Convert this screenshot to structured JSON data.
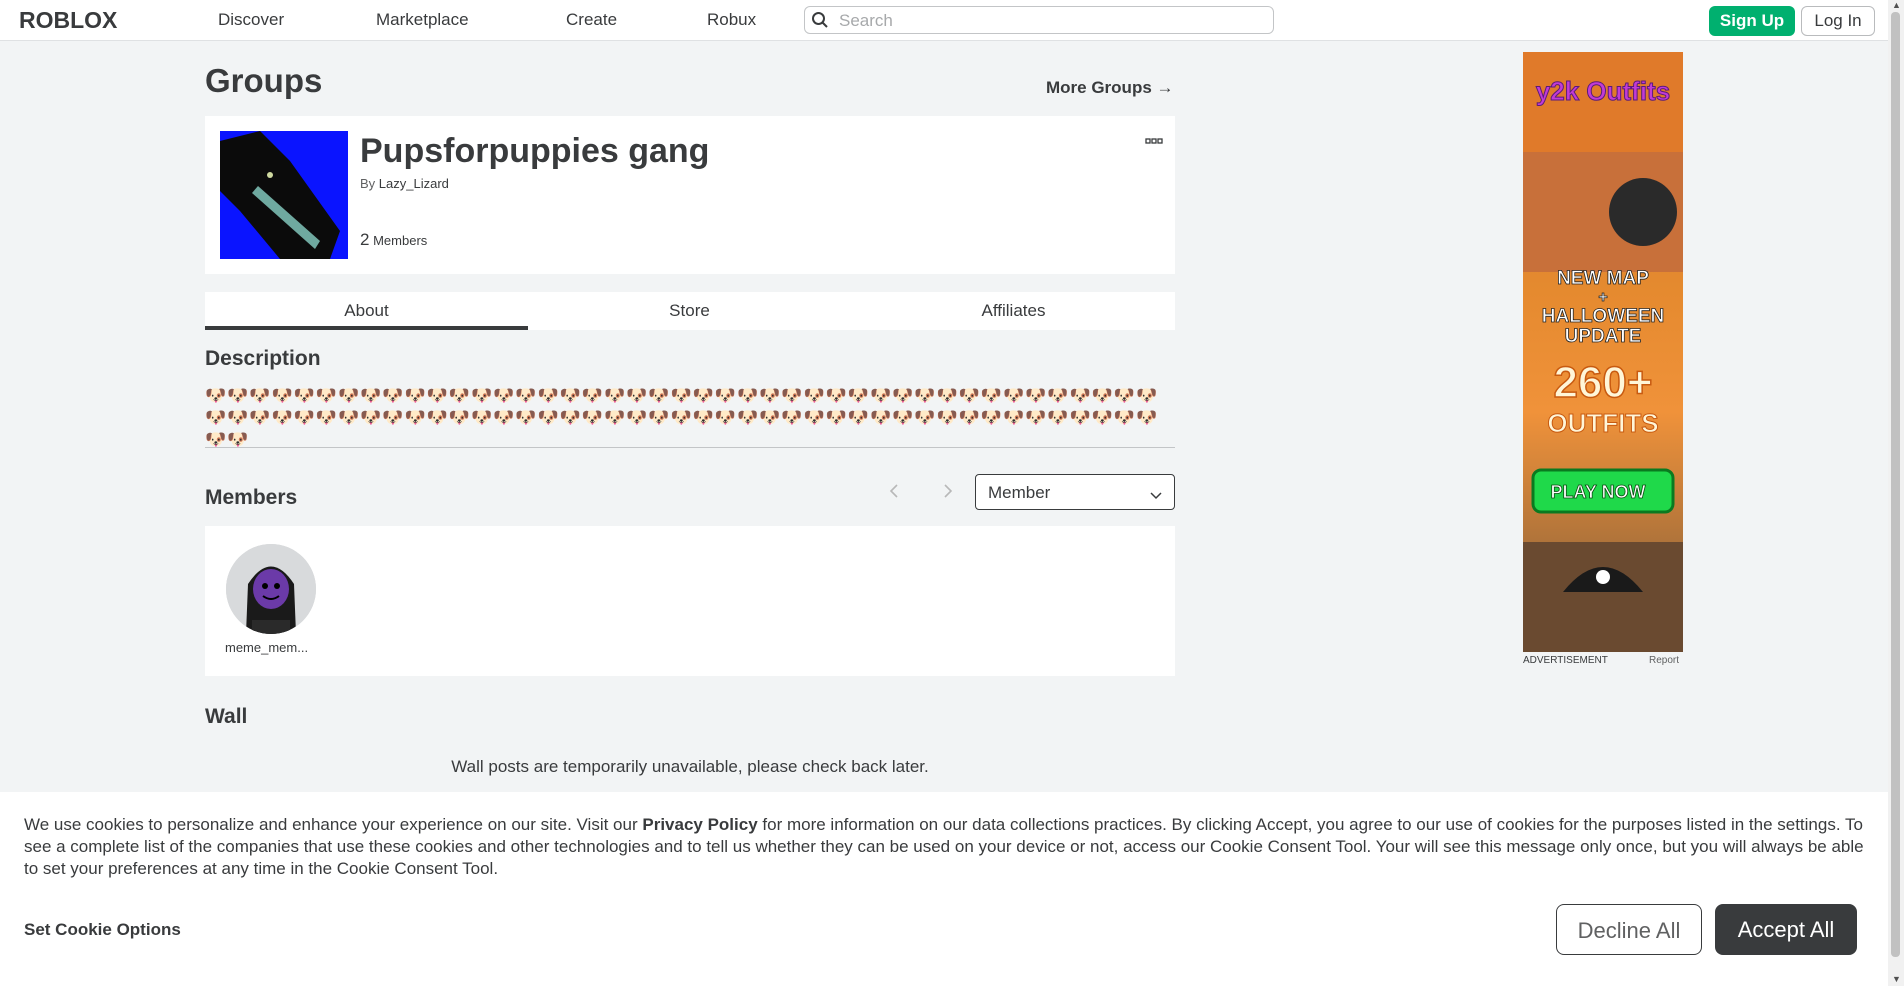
{
  "header": {
    "logo_text": "ROBLOX",
    "nav": [
      "Discover",
      "Marketplace",
      "Create",
      "Robux"
    ],
    "search_placeholder": "Search",
    "signup_label": "Sign Up",
    "login_label": "Log In"
  },
  "page": {
    "title": "Groups",
    "more_groups_label": "More Groups →"
  },
  "group": {
    "name": "Pupsforpuppies gang",
    "by_prefix": "By",
    "owner": "Lazy_Lizard",
    "member_count": "2",
    "members_label": "Members",
    "menu_icon": "ellipsis-icon"
  },
  "tabs": [
    "About",
    "Store",
    "Affiliates"
  ],
  "description": {
    "heading": "Description",
    "text": "🐶🐶🐶🐶🐶🐶🐶🐶🐶🐶🐶🐶🐶🐶🐶🐶🐶🐶🐶🐶🐶🐶🐶🐶🐶🐶🐶🐶🐶🐶🐶🐶🐶🐶🐶🐶🐶🐶🐶🐶🐶🐶🐶🐶🐶🐶🐶🐶🐶🐶🐶🐶🐶🐶🐶🐶🐶🐶🐶🐶🐶🐶🐶🐶🐶🐶🐶🐶🐶🐶🐶🐶🐶🐶🐶🐶🐶🐶🐶🐶🐶🐶🐶🐶🐶🐶🐶🐶"
  },
  "members": {
    "heading": "Members",
    "role_filter": "Member",
    "list": [
      {
        "name": "meme_mem..."
      }
    ]
  },
  "wall": {
    "heading": "Wall",
    "message": "Wall posts are temporarily unavailable, please check back later."
  },
  "ad": {
    "label": "ADVERTISEMENT",
    "report": "Report",
    "brand": "y2k Outfits",
    "line1": "NEW MAP",
    "line2": "+",
    "line3": "HALLOWEEN",
    "line4": "UPDATE",
    "big": "260+",
    "outfits": "OUTFITS",
    "cta": "PLAY NOW"
  },
  "cookie": {
    "text_before": "We use cookies to personalize and enhance your experience on our site. Visit our ",
    "privacy_link": "Privacy Policy",
    "text_after": " for more information on our data collections practices. By clicking Accept, you agree to our use of cookies for the purposes listed in the settings. To see a complete list of the companies that use these cookies and other technologies and to tell us whether they can be used on your device or not, access our Cookie Consent Tool. Your will see this message only once, but you will always be able to set your preferences at any time in the Cookie Consent Tool.",
    "set_options": "Set Cookie Options",
    "decline": "Decline All",
    "accept": "Accept All"
  }
}
